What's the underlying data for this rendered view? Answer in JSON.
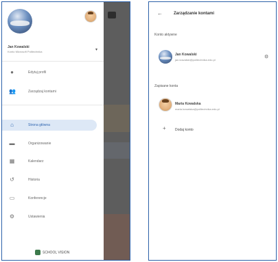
{
  "drawer": {
    "account_name": "Jan Kowalski",
    "account_email": "Konto Microsoft Politechnika",
    "account_chevron": "▾",
    "menu_items": [
      {
        "label": "Edytuj profil",
        "icon": "account-icon"
      },
      {
        "label": "Zarządzaj kontami",
        "icon": "people-icon"
      },
      {
        "label": "Strona główna",
        "icon": "home-icon",
        "active": true
      },
      {
        "label": "Organizowanie",
        "icon": "folder-icon"
      },
      {
        "label": "Kalendarz",
        "icon": "calendar-icon"
      },
      {
        "label": "Historia",
        "icon": "history-icon"
      },
      {
        "label": "Konferencje",
        "icon": "monitor-icon"
      },
      {
        "label": "Ustawienia",
        "icon": "settings-icon"
      }
    ],
    "footer_text": "SCHOOL VISION"
  },
  "accounts_screen": {
    "back_glyph": "←",
    "title": "Zarządzanie kontami",
    "active_section": "Konto aktywne",
    "active_account": {
      "name": "Jan Kowalski",
      "email": "jan.kowalski@politechnika.edu.pl",
      "end_glyph": "⚙"
    },
    "saved_section": "Zapisane konta",
    "saved_account": {
      "name": "Maria Kowalska",
      "email": "maria.kowalska@politechnika.edu.pl"
    },
    "add_label": "Dodaj konto",
    "add_glyph": "+"
  }
}
